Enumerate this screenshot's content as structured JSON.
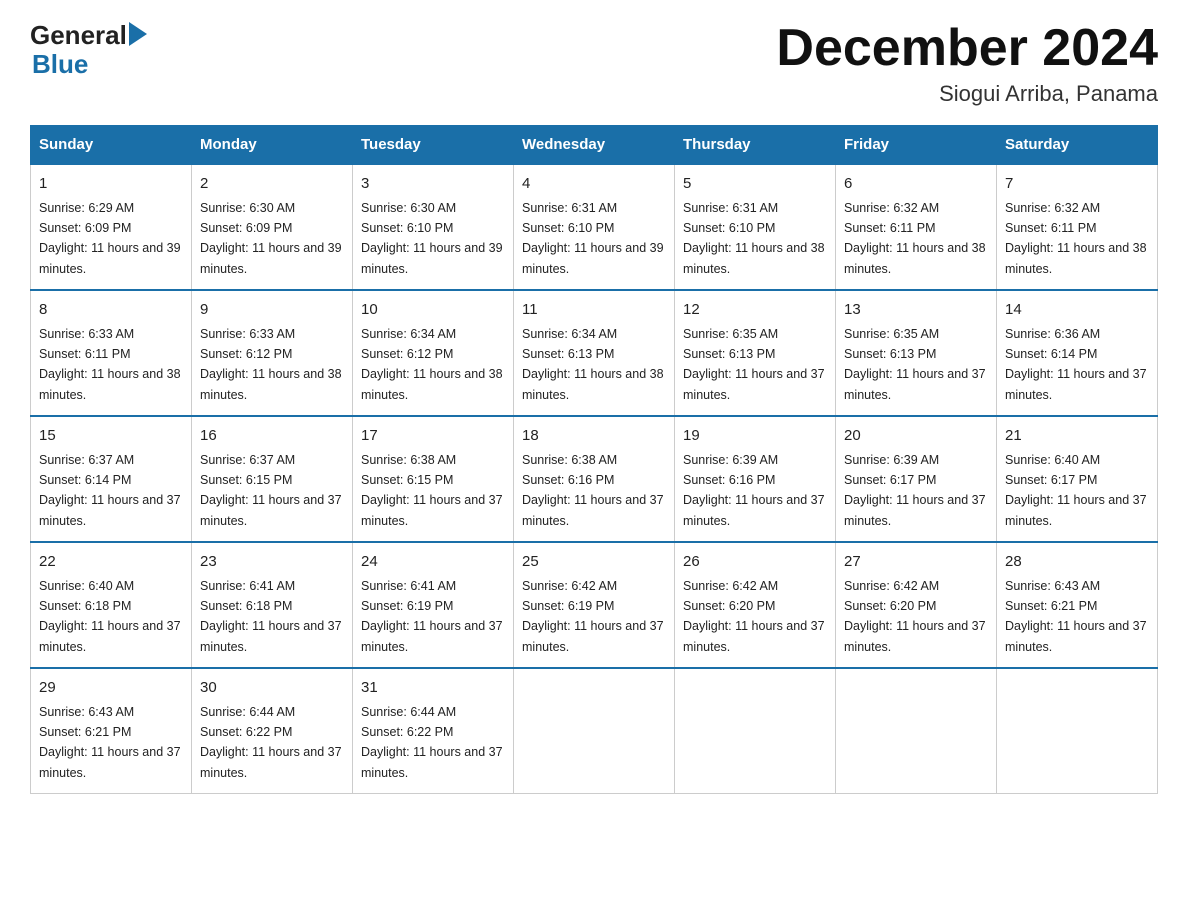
{
  "header": {
    "logo_text_general": "General",
    "logo_text_blue": "Blue",
    "main_title": "December 2024",
    "subtitle": "Siogui Arriba, Panama"
  },
  "calendar": {
    "days_of_week": [
      "Sunday",
      "Monday",
      "Tuesday",
      "Wednesday",
      "Thursday",
      "Friday",
      "Saturday"
    ],
    "weeks": [
      [
        {
          "day": "1",
          "sunrise": "6:29 AM",
          "sunset": "6:09 PM",
          "daylight": "11 hours and 39 minutes."
        },
        {
          "day": "2",
          "sunrise": "6:30 AM",
          "sunset": "6:09 PM",
          "daylight": "11 hours and 39 minutes."
        },
        {
          "day": "3",
          "sunrise": "6:30 AM",
          "sunset": "6:10 PM",
          "daylight": "11 hours and 39 minutes."
        },
        {
          "day": "4",
          "sunrise": "6:31 AM",
          "sunset": "6:10 PM",
          "daylight": "11 hours and 39 minutes."
        },
        {
          "day": "5",
          "sunrise": "6:31 AM",
          "sunset": "6:10 PM",
          "daylight": "11 hours and 38 minutes."
        },
        {
          "day": "6",
          "sunrise": "6:32 AM",
          "sunset": "6:11 PM",
          "daylight": "11 hours and 38 minutes."
        },
        {
          "day": "7",
          "sunrise": "6:32 AM",
          "sunset": "6:11 PM",
          "daylight": "11 hours and 38 minutes."
        }
      ],
      [
        {
          "day": "8",
          "sunrise": "6:33 AM",
          "sunset": "6:11 PM",
          "daylight": "11 hours and 38 minutes."
        },
        {
          "day": "9",
          "sunrise": "6:33 AM",
          "sunset": "6:12 PM",
          "daylight": "11 hours and 38 minutes."
        },
        {
          "day": "10",
          "sunrise": "6:34 AM",
          "sunset": "6:12 PM",
          "daylight": "11 hours and 38 minutes."
        },
        {
          "day": "11",
          "sunrise": "6:34 AM",
          "sunset": "6:13 PM",
          "daylight": "11 hours and 38 minutes."
        },
        {
          "day": "12",
          "sunrise": "6:35 AM",
          "sunset": "6:13 PM",
          "daylight": "11 hours and 37 minutes."
        },
        {
          "day": "13",
          "sunrise": "6:35 AM",
          "sunset": "6:13 PM",
          "daylight": "11 hours and 37 minutes."
        },
        {
          "day": "14",
          "sunrise": "6:36 AM",
          "sunset": "6:14 PM",
          "daylight": "11 hours and 37 minutes."
        }
      ],
      [
        {
          "day": "15",
          "sunrise": "6:37 AM",
          "sunset": "6:14 PM",
          "daylight": "11 hours and 37 minutes."
        },
        {
          "day": "16",
          "sunrise": "6:37 AM",
          "sunset": "6:15 PM",
          "daylight": "11 hours and 37 minutes."
        },
        {
          "day": "17",
          "sunrise": "6:38 AM",
          "sunset": "6:15 PM",
          "daylight": "11 hours and 37 minutes."
        },
        {
          "day": "18",
          "sunrise": "6:38 AM",
          "sunset": "6:16 PM",
          "daylight": "11 hours and 37 minutes."
        },
        {
          "day": "19",
          "sunrise": "6:39 AM",
          "sunset": "6:16 PM",
          "daylight": "11 hours and 37 minutes."
        },
        {
          "day": "20",
          "sunrise": "6:39 AM",
          "sunset": "6:17 PM",
          "daylight": "11 hours and 37 minutes."
        },
        {
          "day": "21",
          "sunrise": "6:40 AM",
          "sunset": "6:17 PM",
          "daylight": "11 hours and 37 minutes."
        }
      ],
      [
        {
          "day": "22",
          "sunrise": "6:40 AM",
          "sunset": "6:18 PM",
          "daylight": "11 hours and 37 minutes."
        },
        {
          "day": "23",
          "sunrise": "6:41 AM",
          "sunset": "6:18 PM",
          "daylight": "11 hours and 37 minutes."
        },
        {
          "day": "24",
          "sunrise": "6:41 AM",
          "sunset": "6:19 PM",
          "daylight": "11 hours and 37 minutes."
        },
        {
          "day": "25",
          "sunrise": "6:42 AM",
          "sunset": "6:19 PM",
          "daylight": "11 hours and 37 minutes."
        },
        {
          "day": "26",
          "sunrise": "6:42 AM",
          "sunset": "6:20 PM",
          "daylight": "11 hours and 37 minutes."
        },
        {
          "day": "27",
          "sunrise": "6:42 AM",
          "sunset": "6:20 PM",
          "daylight": "11 hours and 37 minutes."
        },
        {
          "day": "28",
          "sunrise": "6:43 AM",
          "sunset": "6:21 PM",
          "daylight": "11 hours and 37 minutes."
        }
      ],
      [
        {
          "day": "29",
          "sunrise": "6:43 AM",
          "sunset": "6:21 PM",
          "daylight": "11 hours and 37 minutes."
        },
        {
          "day": "30",
          "sunrise": "6:44 AM",
          "sunset": "6:22 PM",
          "daylight": "11 hours and 37 minutes."
        },
        {
          "day": "31",
          "sunrise": "6:44 AM",
          "sunset": "6:22 PM",
          "daylight": "11 hours and 37 minutes."
        },
        null,
        null,
        null,
        null
      ]
    ]
  }
}
